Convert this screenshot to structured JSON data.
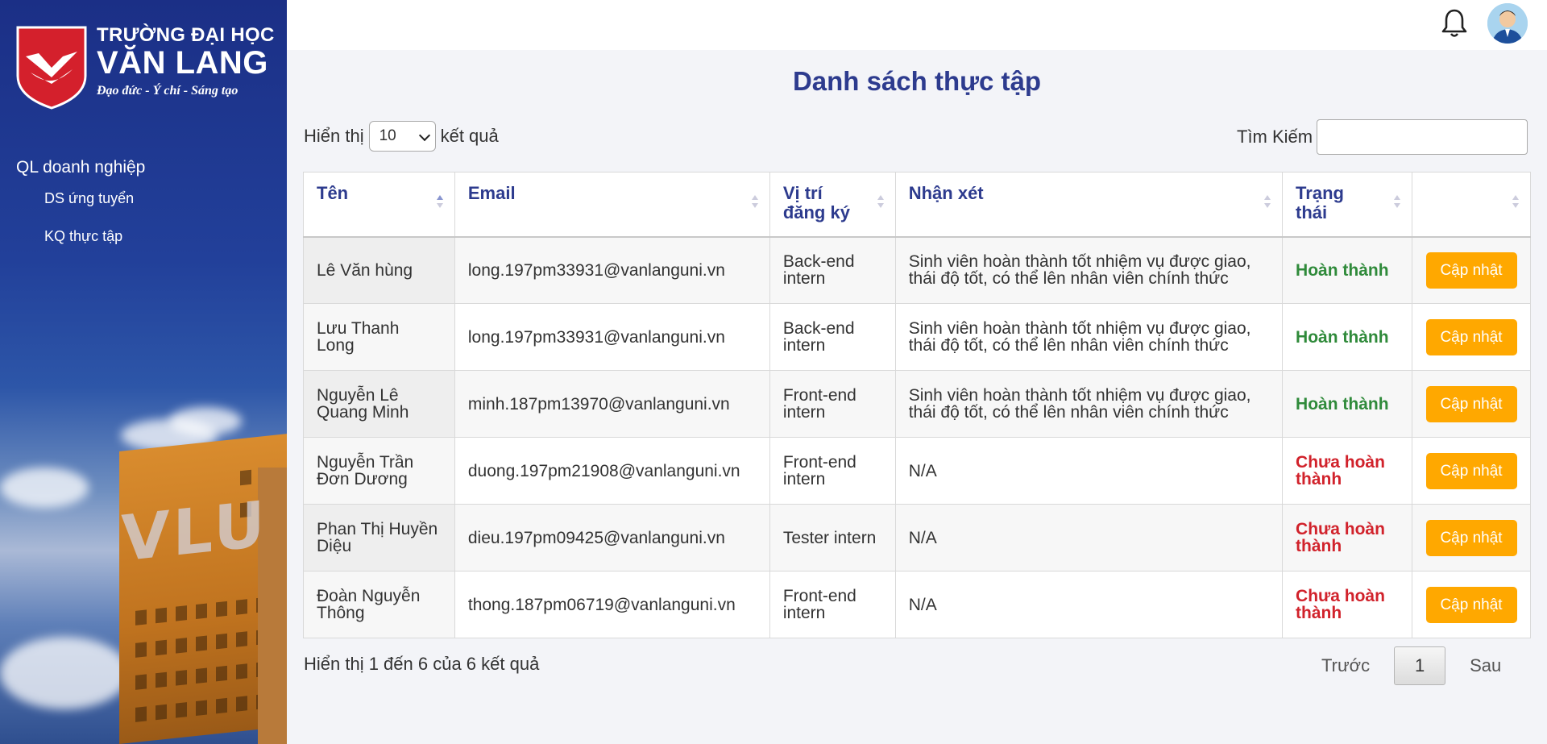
{
  "brand": {
    "line1": "TRƯỜNG ĐẠI HỌC",
    "line2": "VĂN LANG",
    "motto": "Đạo đức - Ý chí - Sáng tạo",
    "color": "#d4202c"
  },
  "sidebar": {
    "section": "QL doanh nghiệp",
    "items": [
      {
        "label": "DS ứng tuyển"
      },
      {
        "label": "KQ thực tập"
      }
    ]
  },
  "header": {
    "notification_icon": "bell-icon",
    "avatar_icon": "user-avatar"
  },
  "page": {
    "title": "Danh sách thực tập",
    "show_prefix": "Hiển thị",
    "page_size": "10",
    "show_suffix": "kết quả",
    "search_label": "Tìm Kiếm",
    "search_value": ""
  },
  "table": {
    "columns": [
      {
        "label": "Tên"
      },
      {
        "label": "Email"
      },
      {
        "label": "Vị trí đăng ký"
      },
      {
        "label": "Nhận xét"
      },
      {
        "label": "Trạng thái"
      },
      {
        "label": ""
      }
    ],
    "rows": [
      {
        "name": "Lê Văn hùng",
        "email": "long.197pm33931@vanlanguni.vn",
        "position": "Back-end intern",
        "comment": "Sinh viên hoàn thành tốt nhiệm vụ được giao, thái độ tốt, có thể lên nhân viên chính thức",
        "status": "Hoàn thành",
        "done": true,
        "action": "Cập nhật"
      },
      {
        "name": "Lưu Thanh Long",
        "email": "long.197pm33931@vanlanguni.vn",
        "position": "Back-end intern",
        "comment": "Sinh viên hoàn thành tốt nhiệm vụ được giao, thái độ tốt, có thể lên nhân viên chính thức",
        "status": "Hoàn thành",
        "done": true,
        "action": "Cập nhật"
      },
      {
        "name": "Nguyễn Lê Quang Minh",
        "email": "minh.187pm13970@vanlanguni.vn",
        "position": "Front-end intern",
        "comment": "Sinh viên hoàn thành tốt nhiệm vụ được giao, thái độ tốt, có thể lên nhân viên chính thức",
        "status": "Hoàn thành",
        "done": true,
        "action": "Cập nhật"
      },
      {
        "name": "Nguyễn Trần Đơn Dương",
        "email": "duong.197pm21908@vanlanguni.vn",
        "position": "Front-end intern",
        "comment": "N/A",
        "status": "Chưa hoàn thành",
        "done": false,
        "action": "Cập nhật"
      },
      {
        "name": "Phan Thị Huyền Diệu",
        "email": "dieu.197pm09425@vanlanguni.vn",
        "position": "Tester intern",
        "comment": "N/A",
        "status": "Chưa hoàn thành",
        "done": false,
        "action": "Cập nhật"
      },
      {
        "name": "Đoàn Nguyễn Thông",
        "email": "thong.187pm06719@vanlanguni.vn",
        "position": "Front-end intern",
        "comment": "N/A",
        "status": "Chưa hoàn thành",
        "done": false,
        "action": "Cập nhật"
      }
    ]
  },
  "footer": {
    "info": "Hiển thị 1 đến 6 của 6 kết quả",
    "prev": "Trước",
    "current_page": "1",
    "next": "Sau"
  },
  "colors": {
    "accent": "#2d3b8e",
    "button": "#ffa800",
    "done": "#2f8a3a",
    "pending": "#d1222b"
  }
}
